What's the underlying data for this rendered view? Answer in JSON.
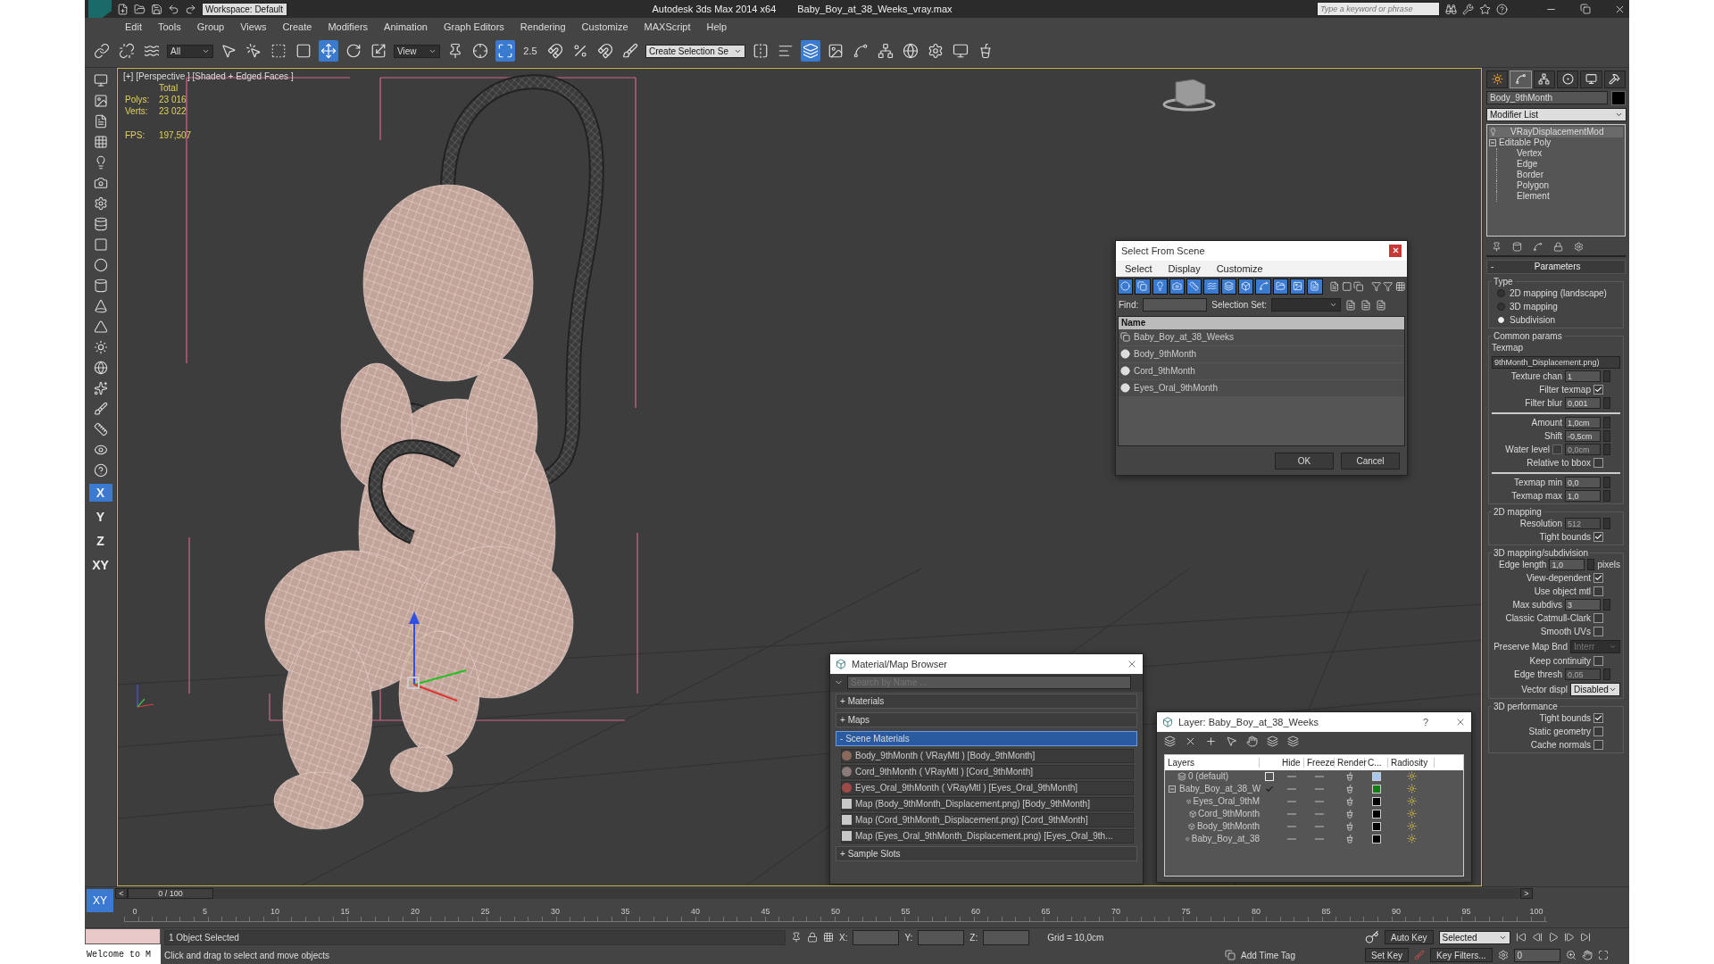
{
  "title_bar": {
    "workspace": "Workspace: Default",
    "app_title": "Autodesk 3ds Max  2014 x64",
    "file_name": "Baby_Boy_at_38_Weeks_vray.max",
    "search": {
      "placeholder": "Type a keyword or phrase"
    }
  },
  "menu": [
    "Edit",
    "Tools",
    "Group",
    "Views",
    "Create",
    "Modifiers",
    "Animation",
    "Graph Editors",
    "Rendering",
    "Customize",
    "MAXScript",
    "Help"
  ],
  "toolbar": {
    "selection_filter": "All",
    "reference_coord": "View",
    "snap_label": "2.5",
    "named_selection": "Create Selection Se"
  },
  "left_toolbar": {
    "axes": [
      {
        "label": "X",
        "selected": true
      },
      {
        "label": "Y",
        "selected": false
      },
      {
        "label": "Z",
        "selected": false
      },
      {
        "label": "XY",
        "selected": false
      }
    ]
  },
  "viewport": {
    "label": "[+] [Perspective ] [Shaded + Edged Faces ]",
    "stats_header": "Total",
    "stats": [
      {
        "label": "Polys:",
        "value": "23 016"
      },
      {
        "label": "Verts:",
        "value": "23 022"
      },
      {
        "label": "FPS:",
        "value": "197,507"
      }
    ]
  },
  "select_from_scene": {
    "title": "Select From Scene",
    "menu": [
      "Select",
      "Display",
      "Customize"
    ],
    "find_label": "Find:",
    "selection_set_label": "Selection Set:",
    "column": "Name",
    "rows": [
      {
        "name": "Baby_Boy_at_38_Weeks",
        "kind": "group"
      },
      {
        "name": "Body_9thMonth",
        "kind": "object"
      },
      {
        "name": "Cord_9thMonth",
        "kind": "object"
      },
      {
        "name": "Eyes_Oral_9thMonth",
        "kind": "object"
      }
    ],
    "buttons": [
      "OK",
      "Cancel"
    ]
  },
  "material_browser": {
    "title": "Material/Map Browser",
    "search": {
      "placeholder": "Search by Name ..."
    },
    "sections": [
      {
        "toggle": "+",
        "label": "Materials",
        "expanded": false
      },
      {
        "toggle": "+",
        "label": "Maps",
        "expanded": false
      },
      {
        "toggle": "-",
        "label": "Scene Materials",
        "expanded": true,
        "items": [
          {
            "label": "Body_9thMonth  ( VRayMtl ) [Body_9thMonth]",
            "kind": "material",
            "color": "#8a6a5a"
          },
          {
            "label": "Cord_9thMonth  ( VRayMtl ) [Cord_9thMonth]",
            "kind": "material",
            "color": "#8a7a78"
          },
          {
            "label": "Eyes_Oral_9thMonth  ( VRayMtl ) [Eyes_Oral_9thMonth]",
            "kind": "material",
            "color": "#a04a48"
          },
          {
            "label": "Map (Body_9thMonth_Displacement.png) [Body_9thMonth]",
            "kind": "map",
            "color": "#c8c8c8"
          },
          {
            "label": "Map (Cord_9thMonth_Displacement.png) [Cord_9thMonth]",
            "kind": "map",
            "color": "#c8c8c8"
          },
          {
            "label": "Map (Eyes_Oral_9thMonth_Displacement.png) [Eyes_Oral_9th...",
            "kind": "map",
            "color": "#c8c8c8"
          }
        ]
      },
      {
        "toggle": "+",
        "label": "Sample Slots",
        "expanded": false
      }
    ]
  },
  "layer_dialog": {
    "title": "Layer: Baby_Boy_at_38_Weeks",
    "help": "?",
    "columns": [
      "Layers",
      "Hide",
      "Freeze",
      "Render",
      "C...",
      "Radiosity"
    ],
    "rows": [
      {
        "name": "0 (default)",
        "kind": "layer",
        "current": false,
        "color": "#a8c8f0"
      },
      {
        "name": "Baby_Boy_at_38_W",
        "kind": "layer",
        "current": true,
        "expanded": true,
        "color": "#108010",
        "children": [
          {
            "name": "Eyes_Oral_9thM",
            "kind": "object",
            "color": "#000000"
          },
          {
            "name": "Cord_9thMonth",
            "kind": "object",
            "color": "#000000"
          },
          {
            "name": "Body_9thMonth",
            "kind": "object",
            "color": "#000000"
          },
          {
            "name": "Baby_Boy_at_38",
            "kind": "object",
            "color": "#000000"
          }
        ]
      }
    ]
  },
  "command_panel": {
    "tabs": [
      {
        "selected": false
      },
      {
        "selected": true
      },
      {
        "selected": false
      },
      {
        "selected": false
      },
      {
        "selected": false
      },
      {
        "selected": false
      }
    ],
    "object_name": "Body_9thMonth",
    "modifier_list": "Modifier List",
    "stack": [
      {
        "label": "VRayDisplacementMod",
        "kind": "modifier",
        "selected": true
      },
      {
        "label": "Editable Poly",
        "kind": "base",
        "selected": false,
        "expanded": true,
        "children": [
          "Vertex",
          "Edge",
          "Border",
          "Polygon",
          "Element"
        ]
      }
    ],
    "rollout": {
      "toggle": "-",
      "title": "Parameters"
    },
    "groups": [
      {
        "title": "Type",
        "rows": [
          {
            "kind": "radio",
            "label": "2D mapping (landscape)",
            "selected": false
          },
          {
            "kind": "radio",
            "label": "3D mapping",
            "selected": false
          },
          {
            "kind": "radio",
            "label": "Subdivision",
            "selected": true
          }
        ]
      },
      {
        "title": "Common params",
        "rows": [
          {
            "kind": "caption",
            "label": "Texmap"
          },
          {
            "kind": "map_button",
            "label": "9thMonth_Displacement.png)"
          },
          {
            "kind": "spinner",
            "label": "Texture chan",
            "value": "1",
            "disabled": false
          },
          {
            "kind": "check",
            "label": "Filter texmap",
            "checked": true
          },
          {
            "kind": "spinner",
            "label": "Filter blur",
            "value": "0,001",
            "disabled": false
          },
          {
            "kind": "divider"
          },
          {
            "kind": "spinner",
            "label": "Amount",
            "value": "1,0cm",
            "disabled": false
          },
          {
            "kind": "spinner",
            "label": "Shift",
            "value": "-0,5cm",
            "disabled": false
          },
          {
            "kind": "check_spinner",
            "label": "Water level",
            "checked": false,
            "value": "0,0cm",
            "disabled": true
          },
          {
            "kind": "check",
            "label": "Relative to bbox",
            "checked": false
          },
          {
            "kind": "divider"
          },
          {
            "kind": "spinner",
            "label": "Texmap min",
            "value": "0,0",
            "disabled": false
          },
          {
            "kind": "spinner",
            "label": "Texmap max",
            "value": "1,0",
            "disabled": false
          }
        ]
      },
      {
        "title": "2D mapping",
        "rows": [
          {
            "kind": "spinner",
            "label": "Resolution",
            "value": "512",
            "disabled": true
          },
          {
            "kind": "check",
            "label": "Tight bounds",
            "checked": true
          }
        ]
      },
      {
        "title": "3D mapping/subdivision",
        "rows": [
          {
            "kind": "spinner",
            "label": "Edge length",
            "value": "1,0",
            "unit": "pixels",
            "disabled": false
          },
          {
            "kind": "check",
            "label": "View-dependent",
            "checked": true
          },
          {
            "kind": "check",
            "label": "Use object mtl",
            "checked": false
          },
          {
            "kind": "spinner",
            "label": "Max subdivs",
            "value": "3",
            "disabled": false
          },
          {
            "kind": "check",
            "label": "Classic Catmull-Clark",
            "checked": false
          },
          {
            "kind": "check",
            "label": "Smooth UVs",
            "checked": false
          },
          {
            "kind": "dropdown",
            "label": "Preserve Map Bnd",
            "value": "Interr",
            "disabled": true
          },
          {
            "kind": "check",
            "label": "Keep continuity",
            "checked": false
          },
          {
            "kind": "spinner",
            "label": "Edge thresh",
            "value": "0,05",
            "disabled": true
          },
          {
            "kind": "dropdown",
            "label": "Vector displ",
            "value": "Disabled",
            "disabled": false
          }
        ]
      },
      {
        "title": "3D performance",
        "rows": [
          {
            "kind": "check",
            "label": "Tight bounds",
            "checked": true
          },
          {
            "kind": "check",
            "label": "Static geometry",
            "checked": false
          },
          {
            "kind": "check",
            "label": "Cache normals",
            "checked": false
          }
        ]
      }
    ]
  },
  "timeline": {
    "constraint": "XY",
    "prev": "<",
    "next": ">",
    "slider_label": "0 / 100",
    "level": 0,
    "ticks": [
      "0",
      "5",
      "10",
      "15",
      "20",
      "25",
      "30",
      "35",
      "40",
      "45",
      "50",
      "55",
      "60",
      "65",
      "70",
      "75",
      "80",
      "85",
      "90",
      "95",
      "100"
    ]
  },
  "status_bar": {
    "listener": "Welcome to M",
    "selection": "1 Object Selected",
    "prompt": "Click and drag to select and move objects",
    "coords": [
      "X:",
      "Y:",
      "Z:"
    ],
    "grid": "Grid = 10,0cm",
    "add_time_tag": "Add Time Tag",
    "auto_key": "Auto Key",
    "key_mode": "Selected",
    "set_key": "Set Key",
    "key_filters": "Key Filters...",
    "frame": "0"
  }
}
